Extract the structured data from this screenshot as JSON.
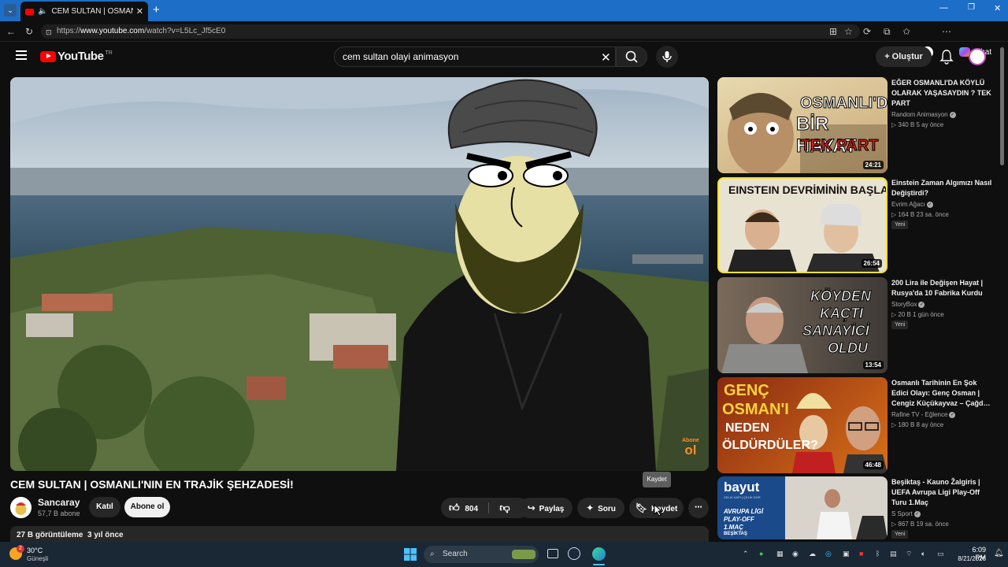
{
  "browser": {
    "tab_title": "CEM SULTAN | OSMANLI'NIN",
    "url_prefix": "https://",
    "url_host": "www.youtube.com",
    "url_path": "/watch?v=L5Lc_Jf5cE0",
    "chat_label": "Chat"
  },
  "header": {
    "logo_text": "YouTube",
    "country_code": "TR",
    "search_value": "cem sultan olayi animasyon",
    "create_label": "Oluştur"
  },
  "video": {
    "title": "CEM SULTAN | OSMANLI'NIN EN TRAJİK ŞEHZADESİ!",
    "watermark_top": "Abone",
    "watermark_bottom": "ol",
    "channel_name": "Sancaray",
    "subscribers": "57,7 B abone",
    "join_label": "Katıl",
    "subscribe_label": "Abone ol",
    "likes": "804",
    "share_label": "Paylaş",
    "ask_label": "Soru",
    "save_label": "Kaydet",
    "save_tooltip": "Kaydet",
    "views_and_date": "27 B görüntüleme  3 yıl önce"
  },
  "recommendations": [
    {
      "title": "EĞER OSMANLI'DA KÖYLÜ OLARAK YAŞASAYDIN ? TEK PART",
      "channel": "Random Animasyon",
      "meta": "▷ 340 B  5 ay önce",
      "duration": "24:21",
      "badge": "",
      "thumb_text": [
        "OSMANLI'DA",
        "BİR HAYAT",
        "TEK PART"
      ]
    },
    {
      "title": "Einstein Zaman Algımızı Nasıl Değiştirdi?",
      "channel": "Evrim Ağacı",
      "meta": "▷ 164 B  23 sa. önce",
      "duration": "26:54",
      "badge": "Yeni",
      "thumb_text": [
        "EINSTEIN DEVRİMİNİN BAŞLANGICI"
      ]
    },
    {
      "title": "200 Lira ile Değişen Hayat | Rusya'da 10 Fabrika Kurdu",
      "channel": "StoryBox",
      "meta": "▷ 20 B  1 gün önce",
      "duration": "13:54",
      "badge": "Yeni",
      "thumb_text": [
        "KÖYDEN",
        "KAÇTI",
        "SANAYİCİ",
        "OLDU"
      ]
    },
    {
      "title": "Osmanlı Tarihinin En Şok Edici Olayı: Genç Osman | Cengiz Küçükayvaz – Çağd…",
      "channel": "Rafine TV - Eğlence",
      "meta": "▷ 180 B  8 ay önce",
      "duration": "46:48",
      "badge": "",
      "thumb_text": [
        "GENÇ",
        "OSMAN'I",
        "NEDEN",
        "ÖLDÜRDÜLER?"
      ]
    },
    {
      "title": "Beşiktaş - Kauno Žalgiris | UEFA Avrupa Ligi Play-Off Turu 1.Maç",
      "channel": "S Sport",
      "meta": "▷ 867 B  19 sa. önce",
      "duration": "",
      "badge": "Yeni",
      "thumb_text": [
        "bayut",
        "CELIK KAPI | ÇELİK DOR",
        "AVRUPA LİGİ",
        "PLAY-OFF",
        "1.MAÇ",
        "BEŞİKTAŞ"
      ]
    }
  ],
  "taskbar": {
    "temperature": "30°C",
    "condition": "Güneşli",
    "search_placeholder": "Search",
    "time": "6:09 PM",
    "date": "8/21/2026",
    "weather_badge": "2"
  }
}
